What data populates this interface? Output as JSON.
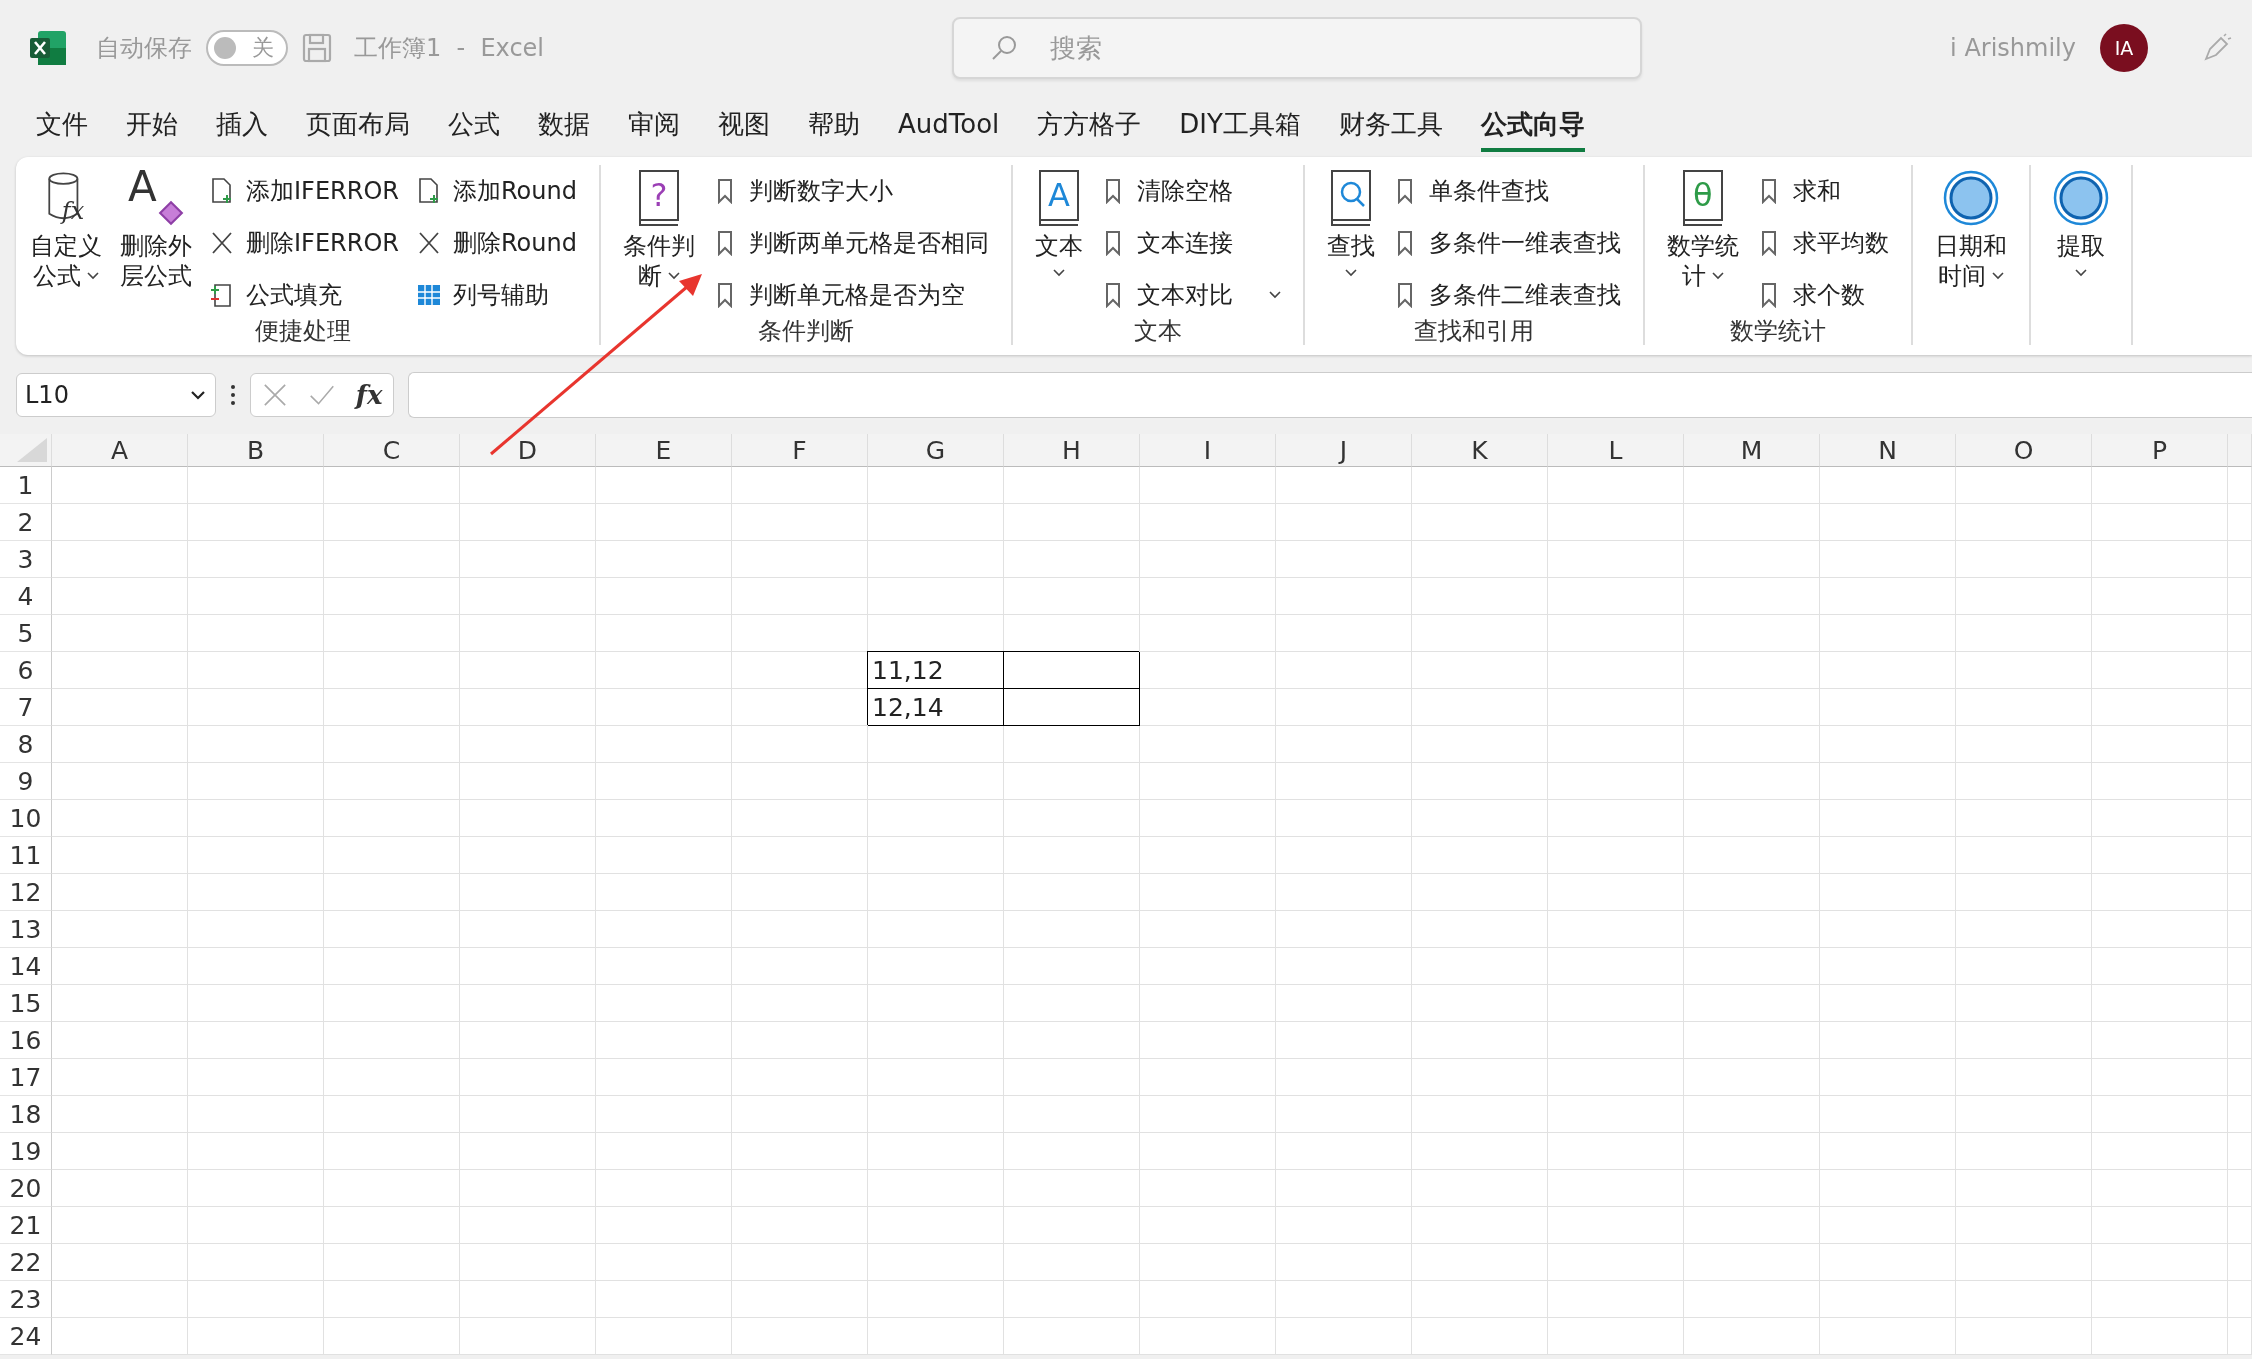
{
  "titlebar": {
    "autosave_label": "自动保存",
    "autosave": {
      "on": false,
      "label": "关"
    },
    "document_title": "工作簿1  -  Excel",
    "search": {
      "placeholder": "搜索"
    },
    "user_name": "i Arishmily",
    "avatar_initials": "IA"
  },
  "tabs": [
    {
      "label": "文件",
      "selected": false
    },
    {
      "label": "开始",
      "selected": false
    },
    {
      "label": "插入",
      "selected": false
    },
    {
      "label": "页面布局",
      "selected": false
    },
    {
      "label": "公式",
      "selected": false
    },
    {
      "label": "数据",
      "selected": false
    },
    {
      "label": "审阅",
      "selected": false
    },
    {
      "label": "视图",
      "selected": false
    },
    {
      "label": "帮助",
      "selected": false
    },
    {
      "label": "AudTool",
      "selected": false
    },
    {
      "label": "方方格子",
      "selected": false
    },
    {
      "label": "DIY工具箱",
      "selected": false
    },
    {
      "label": "财务工具",
      "selected": false
    },
    {
      "label": "公式向导",
      "selected": true
    }
  ],
  "ribbon": {
    "groups": [
      {
        "label": "便捷处理",
        "items": [
          {
            "kind": "large",
            "glyph": "fx",
            "lines": [
              "自定义",
              "公式"
            ],
            "dropdown": true
          },
          {
            "kind": "large",
            "glyph": "A",
            "lines": [
              "删除外",
              "层公式"
            ],
            "dropdown": false
          },
          {
            "kind": "column",
            "entries": [
              {
                "label": "添加IFERROR",
                "dropdown": false
              },
              {
                "label": "删除IFERROR",
                "dropdown": false
              },
              {
                "label": "公式填充",
                "dropdown": false
              }
            ]
          },
          {
            "kind": "column",
            "entries": [
              {
                "label": "添加Round",
                "dropdown": false
              },
              {
                "label": "删除Round",
                "dropdown": false
              },
              {
                "label": "列号辅助",
                "dropdown": false
              }
            ]
          }
        ]
      },
      {
        "label": "条件判断",
        "items": [
          {
            "kind": "large",
            "glyph": "?",
            "lines": [
              "条件判",
              "断"
            ],
            "dropdown": true
          },
          {
            "kind": "column",
            "entries": [
              {
                "label": "判断数字大小",
                "dropdown": false
              },
              {
                "label": "判断两单元格是否相同",
                "dropdown": false
              },
              {
                "label": "判断单元格是否为空",
                "dropdown": false
              }
            ]
          }
        ]
      },
      {
        "label": "文本",
        "items": [
          {
            "kind": "large",
            "glyph": "A",
            "lines": [
              "文本"
            ],
            "dropdown": true
          },
          {
            "kind": "column",
            "entries": [
              {
                "label": "清除空格",
                "dropdown": false
              },
              {
                "label": "文本连接",
                "dropdown": false
              },
              {
                "label": "文本对比",
                "dropdown": true
              }
            ]
          }
        ]
      },
      {
        "label": "查找和引用",
        "items": [
          {
            "kind": "large",
            "lines": [
              "查找"
            ],
            "dropdown": true
          },
          {
            "kind": "column",
            "entries": [
              {
                "label": "单条件查找",
                "dropdown": false
              },
              {
                "label": "多条件一维表查找",
                "dropdown": false
              },
              {
                "label": "多条件二维表查找",
                "dropdown": false
              }
            ]
          }
        ]
      },
      {
        "label": "数学统计",
        "items": [
          {
            "kind": "large",
            "glyph": "θ",
            "lines": [
              "数学统",
              "计"
            ],
            "dropdown": true
          },
          {
            "kind": "column",
            "entries": [
              {
                "label": "求和",
                "dropdown": false
              },
              {
                "label": "求平均数",
                "dropdown": false
              },
              {
                "label": "求个数",
                "dropdown": false
              }
            ]
          }
        ]
      },
      {
        "items": [
          {
            "kind": "large",
            "lines": [
              "日期和",
              "时间"
            ],
            "dropdown": true
          }
        ]
      },
      {
        "items": [
          {
            "kind": "large",
            "lines": [
              "提取"
            ],
            "dropdown": true
          }
        ]
      }
    ]
  },
  "formula_bar": {
    "name_box": "L10",
    "fx_label": "fx"
  },
  "sheet": {
    "columns": [
      "A",
      "B",
      "C",
      "D",
      "E",
      "F",
      "G",
      "H",
      "I",
      "J",
      "K",
      "L",
      "M",
      "N",
      "O",
      "P"
    ],
    "rows": [
      {
        "header": "1"
      },
      {
        "header": "2"
      },
      {
        "header": "3"
      },
      {
        "header": "4"
      },
      {
        "header": "5"
      },
      {
        "header": "6",
        "cells": [
          {
            "value": "11,12",
            "bordered": true
          },
          {
            "bordered": true
          }
        ]
      },
      {
        "header": "7",
        "cells": [
          {
            "value": "12,14",
            "bordered": true
          },
          {
            "bordered": true
          }
        ]
      },
      {
        "header": "8"
      },
      {
        "header": "9"
      },
      {
        "header": "10"
      },
      {
        "header": "11"
      },
      {
        "header": "12"
      },
      {
        "header": "13"
      },
      {
        "header": "14"
      },
      {
        "header": "15"
      },
      {
        "header": "16"
      },
      {
        "header": "17"
      },
      {
        "header": "18"
      },
      {
        "header": "19"
      },
      {
        "header": "20"
      },
      {
        "header": "21"
      },
      {
        "header": "22"
      },
      {
        "header": "23"
      },
      {
        "header": "24"
      }
    ]
  }
}
